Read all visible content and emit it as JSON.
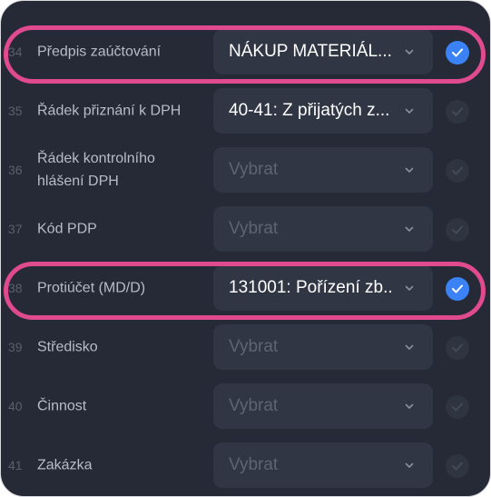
{
  "placeholder": "Vybrat",
  "colors": {
    "panel_bg": "#262a36",
    "select_bg": "#313644",
    "accent_blue": "#3b82f6",
    "highlight_pink": "#e04a8e"
  },
  "rows": [
    {
      "num": "34",
      "label": "Předpis zaúčtování",
      "value": "NÁKUP MATERIÁL...",
      "checked": true
    },
    {
      "num": "35",
      "label": "Řádek přiznání k DPH",
      "value": "40-41: Z přijatých z...",
      "checked": false
    },
    {
      "num": "36",
      "label": "Řádek kontrolního hlášení DPH",
      "value": "Vybrat",
      "checked": false
    },
    {
      "num": "37",
      "label": "Kód PDP",
      "value": "Vybrat",
      "checked": false
    },
    {
      "num": "38",
      "label": "Protiúčet (MD/D)",
      "value": "131001: Pořízení zb...",
      "checked": true
    },
    {
      "num": "39",
      "label": "Středisko",
      "value": "Vybrat",
      "checked": false
    },
    {
      "num": "40",
      "label": "Činnost",
      "value": "Vybrat",
      "checked": false
    },
    {
      "num": "41",
      "label": "Zakázka",
      "value": "Vybrat",
      "checked": false
    }
  ]
}
